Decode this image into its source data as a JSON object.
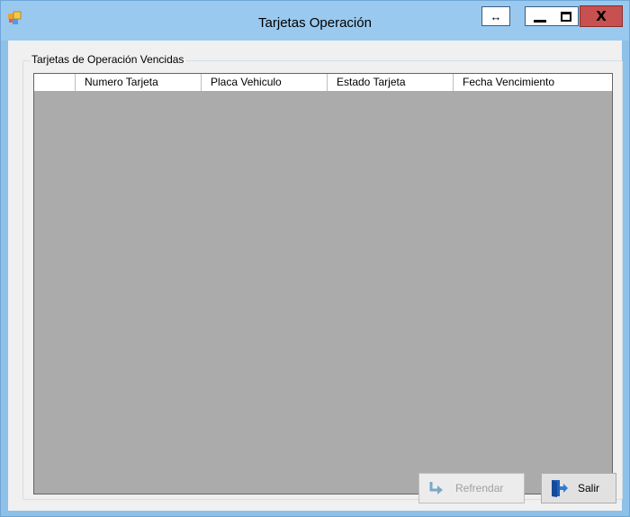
{
  "window": {
    "title": "Tarjetas Operación",
    "resize_glyph": "↔",
    "close_glyph": "X"
  },
  "group": {
    "caption": "Tarjetas de Operación Vencidas"
  },
  "grid": {
    "columns": [
      "Numero Tarjeta",
      "Placa Vehiculo",
      "Estado Tarjeta",
      "Fecha Vencimiento"
    ],
    "rows": []
  },
  "buttons": {
    "refrendar_label": "Refrendar",
    "salir_label": "Salir"
  },
  "colors": {
    "titlebar": "#99c9ef",
    "close": "#c75050",
    "grid_background": "#ababab",
    "form_background": "#f0f0f0"
  },
  "icons": {
    "app": "app-icon",
    "refrendar": "arrow-turn-right-icon",
    "salir": "exit-door-icon"
  }
}
